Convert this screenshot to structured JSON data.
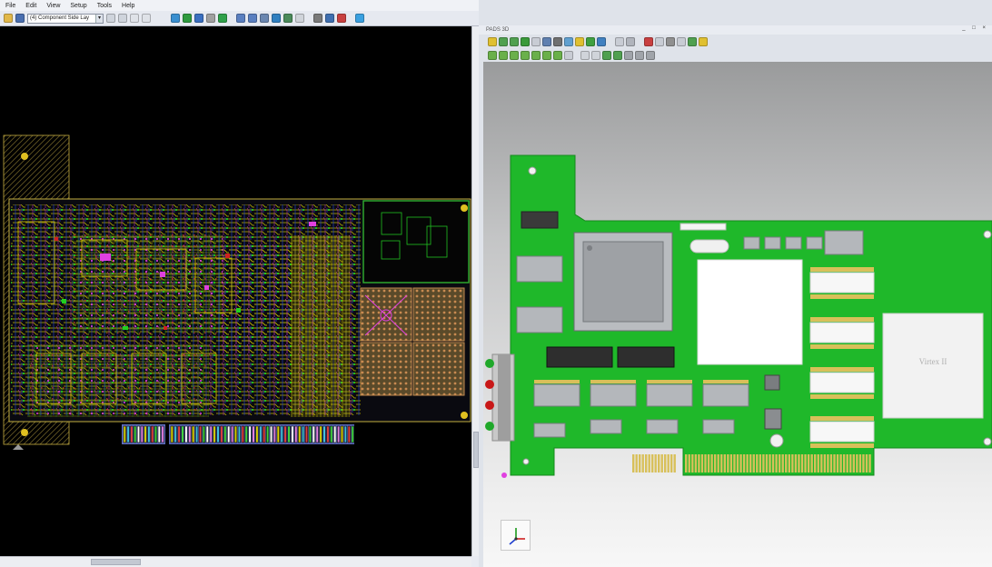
{
  "menu": [
    "File",
    "Edit",
    "View",
    "Setup",
    "Tools",
    "Help"
  ],
  "left_toolbar": {
    "layer_select_value": "(4) Component Side Lay",
    "icons": [
      "open-icon",
      "save-icon",
      "copy-icon",
      "paste-icon",
      "undo-icon",
      "redo-icon",
      "layers-icon",
      "route-icon",
      "zoom-icon",
      "select-icon",
      "measure-icon",
      "refresh-icon",
      "zoom-in-icon",
      "settings-icon",
      "rule-icon",
      "plane-icon",
      "find-icon",
      "highlight-icon",
      "3d-view-icon"
    ]
  },
  "right_window": {
    "title": "PADS 3D",
    "controls": "_ □ ×",
    "toolbar1_icons": [
      "home-icon",
      "prev-icon",
      "next-icon",
      "play-icon",
      "fit-icon",
      "export-icon",
      "print-icon",
      "settings-icon",
      "filter-icon",
      "pan-icon",
      "zoom-icon",
      "rotate-icon",
      "snapshot-icon",
      "measure-icon",
      "section-icon",
      "light-icon",
      "grid-icon",
      "refresh-icon"
    ],
    "toolbar2_icons": [
      "view-top-icon",
      "view-bottom-icon",
      "view-front-icon",
      "view-back-icon",
      "view-left-icon",
      "view-right-icon",
      "view-iso-icon",
      "view-fit-icon",
      "box-icon",
      "wire-icon",
      "solid-icon",
      "transparent-icon",
      "highlight-icon",
      "rotate-icon",
      "undo-icon",
      "redo-icon"
    ],
    "chip_label": "Virtex II"
  },
  "colors": {
    "pcb_background": "#000000",
    "board_green": "#1fb82a",
    "gold_finger": "#d8c05a",
    "trace_yellow": "#d9d000",
    "trace_magenta": "#e040e0",
    "trace_green": "#20c020"
  }
}
